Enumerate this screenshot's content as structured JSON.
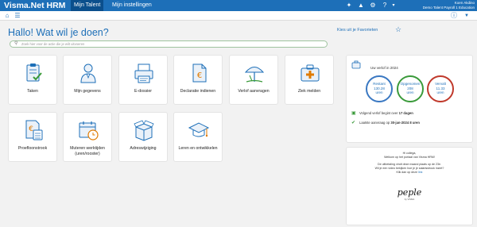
{
  "app": {
    "brand": "Visma.Net HRM",
    "tabs": [
      {
        "label": "Mijn Talent"
      },
      {
        "label": "Mijn instellingen"
      }
    ],
    "user": {
      "name": "Koen Akdino",
      "org": "Demo Talent Payroll 1 Education"
    }
  },
  "main": {
    "greeting": "Hallo! Wat wil je doen?",
    "search_placeholder": "Zoek hier voor de actie die je wilt uitvoeren",
    "favorites_link": "Kies uit je Favorieten",
    "tiles": [
      {
        "label": "Taken"
      },
      {
        "label": "Mijn gegevens"
      },
      {
        "label": "E-dossier"
      },
      {
        "label": "Declaratie indienen"
      },
      {
        "label": "Verlof aanvragen"
      },
      {
        "label": "Ziek melden"
      },
      {
        "label": "Proefloonstrook"
      },
      {
        "label": "Muteren werktijden (uren/rooster)"
      },
      {
        "label": "Adreswijziging"
      },
      {
        "label": "Leren en ontwikkelen"
      }
    ]
  },
  "leave": {
    "title": "Uw verlof in 2024",
    "rest": {
      "label": "Restant",
      "value": "130.28",
      "unit": "uren",
      "color": "#3a78c2"
    },
    "taken": {
      "label": "Opgenomen",
      "value": "208",
      "unit": "uren",
      "color": "#3a9a3a"
    },
    "expired": {
      "label": "Vervalt",
      "value": "11.33",
      "unit": "uren",
      "color": "#c0392b"
    },
    "next_prefix": "Volgend verlof begint over",
    "next_value": "17 dagen",
    "last_prefix": "Laatste aanvraag op",
    "last_value": "30-jan-2024 8 uren"
  },
  "welcome": {
    "greeting": "Hi collega,",
    "line1": "Welkom op het portaal van Visma HRM!",
    "line2": "De uitbetaling vindt deze maand plaats op de 23e.",
    "line3": "Wil je een video bekijken hoe je je salarisstrook inziet?",
    "line4_prefix": "Klik dan op deze",
    "line4_link": "link",
    "logo": "peple",
    "logo_sub": "by VISMA"
  }
}
